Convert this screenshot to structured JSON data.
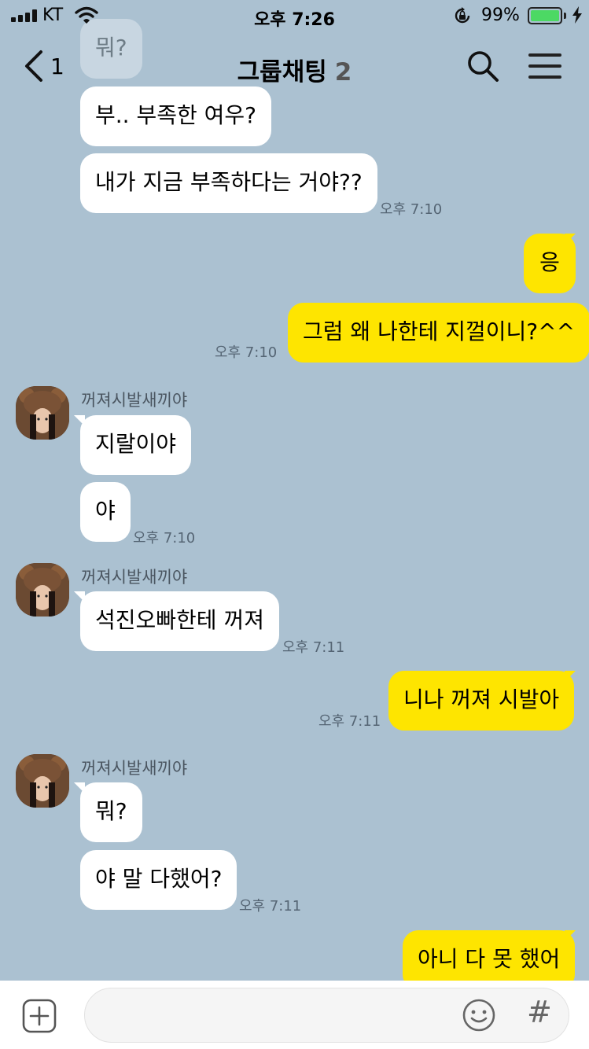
{
  "status_bar": {
    "carrier": "KT",
    "time": "오후 7:26",
    "battery_percent": "99%",
    "battery_level": 0.99
  },
  "header": {
    "back_count": "1",
    "title": "그룹채팅",
    "member_count": "2"
  },
  "colors": {
    "background": "#abc1d1",
    "my_bubble": "#fee500",
    "their_bubble": "#ffffff"
  },
  "messages": [
    {
      "text": "뭐?",
      "time": ""
    },
    {
      "text": "부.. 부족한 여우?",
      "time": ""
    },
    {
      "text": "내가 지금 부족하다는 거야??",
      "time": "오후 7:10"
    },
    {
      "text": "응",
      "time": ""
    },
    {
      "text": "그럼 왜 나한테 지껄이니?^^",
      "time": "오후 7:10"
    },
    {
      "sender": "꺼져시발새끼야",
      "text": "지랄이야",
      "time": ""
    },
    {
      "text": "야",
      "time": "오후 7:10"
    },
    {
      "sender": "꺼져시발새끼야",
      "text": "석진오빠한테 꺼져",
      "time": "오후 7:11"
    },
    {
      "text": "니나 꺼져 시발아",
      "time": "오후 7:11"
    },
    {
      "sender": "꺼져시발새끼야",
      "text": "뭐?",
      "time": ""
    },
    {
      "text": "야 말 다했어?",
      "time": "오후 7:11"
    },
    {
      "text": "아니 다 못 했어",
      "time": ""
    }
  ],
  "input": {
    "placeholder": "",
    "plus_icon": "plus-icon",
    "emoji_icon": "emoji-icon",
    "hash_label": "#"
  }
}
